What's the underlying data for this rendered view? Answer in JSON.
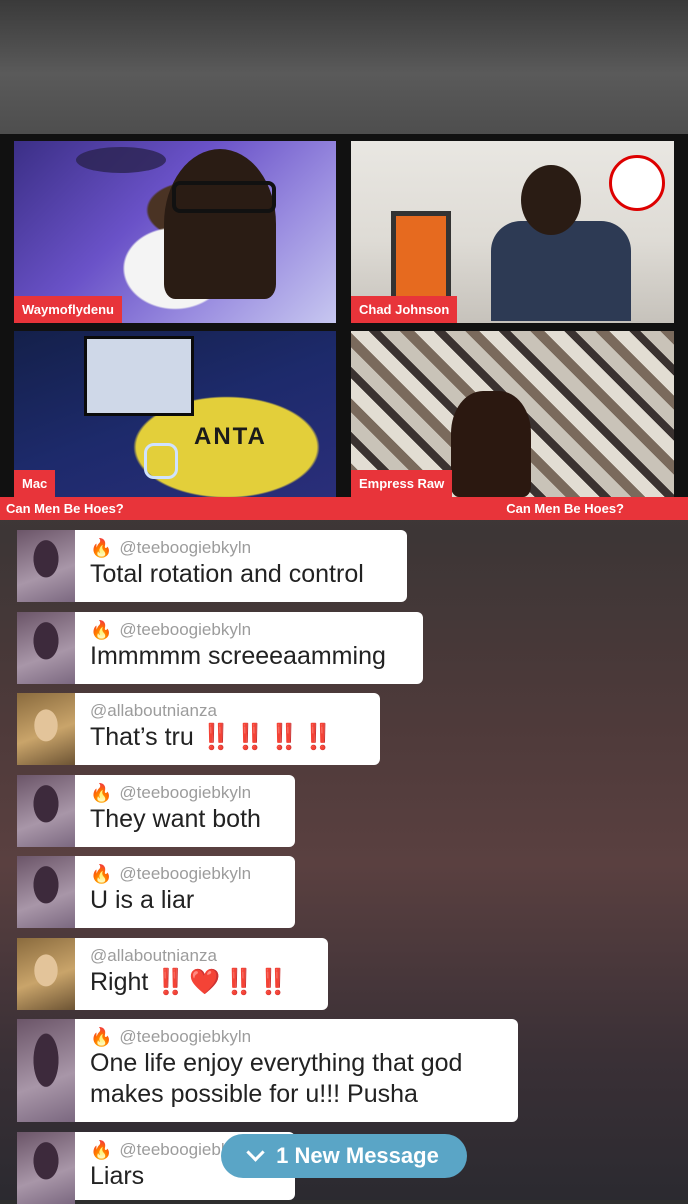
{
  "stream": {
    "participants": [
      {
        "name": "Waymoflydenu"
      },
      {
        "name": "Chad Johnson"
      },
      {
        "name": "Mac"
      },
      {
        "name": "Empress Raw"
      }
    ],
    "caption_left": "Can Men Be Hoes?",
    "caption_right": "Can Men Be Hoes?",
    "tile_overlay_text": {
      "hoodie": "ANTA"
    }
  },
  "chat": {
    "messages": [
      {
        "user": "@teeboogiebkyln",
        "text": "Total rotation and control",
        "flame": true
      },
      {
        "user": "@teeboogiebkyln",
        "text": "Immmmm screeeaamming",
        "flame": true
      },
      {
        "user": "@allaboutnianza",
        "text": "That’s tru",
        "emoji": "‼️ ‼️ ‼️ ‼️",
        "flame": false
      },
      {
        "user": "@teeboogiebkyln",
        "text": "They want both",
        "flame": true
      },
      {
        "user": "@teeboogiebkyln",
        "text": "U is a liar",
        "flame": true
      },
      {
        "user": "@allaboutnianza",
        "text": "Right",
        "emoji": "‼️ ❤️ ‼️ ‼️",
        "flame": false
      },
      {
        "user": "@teeboogiebkyln",
        "text": "One life enjoy everything that god\nmakes possible for u!!! Pusha",
        "flame": true
      },
      {
        "user": "@teeboogiebkyln",
        "text": "Liars",
        "flame": true
      }
    ],
    "new_message_label": "1 New Message"
  },
  "colors": {
    "accent_red": "#e8343a",
    "new_message_pill": "#5aa5c6",
    "flame": "#9a6bd9"
  },
  "icons": {
    "flame": "flame-icon",
    "chevron": "chevron-down-icon"
  }
}
